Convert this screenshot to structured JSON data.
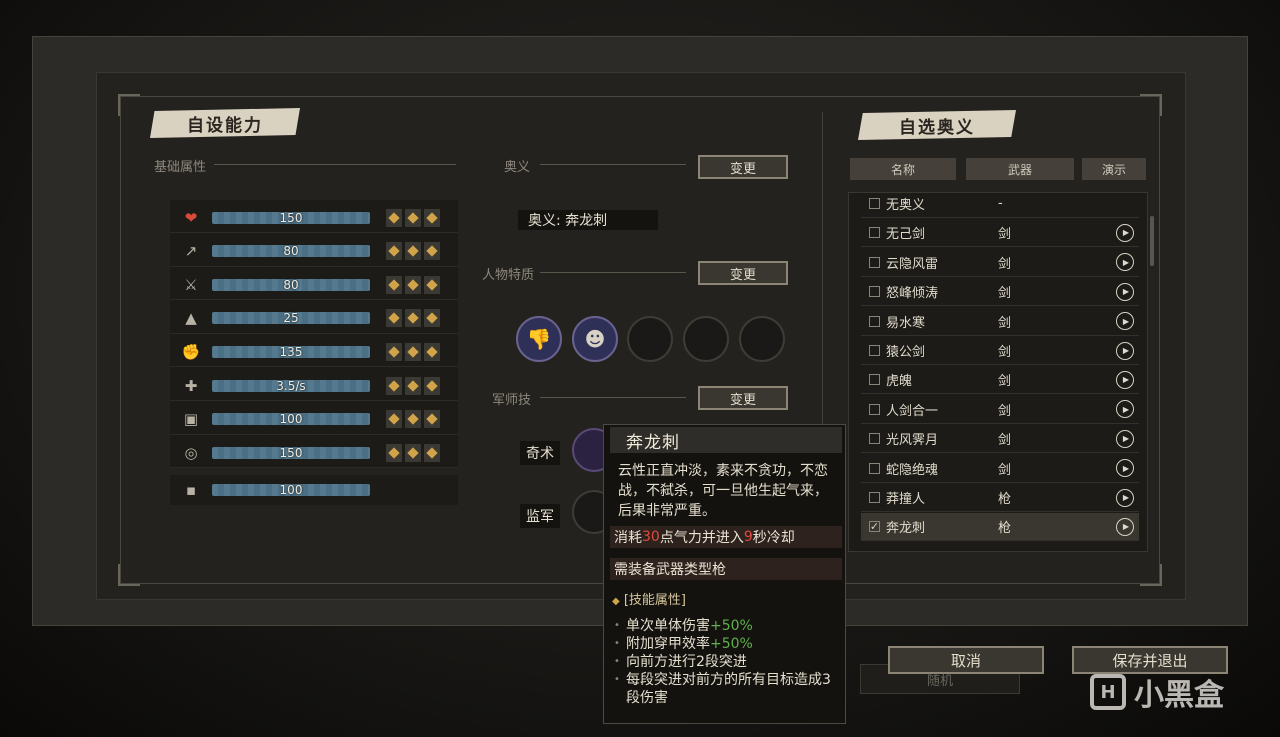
{
  "left_panel": {
    "title": "自设能力",
    "base_attr_label": "基础属性",
    "stats": [
      {
        "icon": "heart-icon",
        "glyph": "❤",
        "value": "150"
      },
      {
        "icon": "spear-icon",
        "glyph": "↗",
        "value": "80"
      },
      {
        "icon": "blade-icon",
        "glyph": "⚔",
        "value": "80"
      },
      {
        "icon": "boot-icon",
        "glyph": "▲",
        "value": "25"
      },
      {
        "icon": "fist-icon",
        "glyph": "✊",
        "value": "135"
      },
      {
        "icon": "regen-icon",
        "glyph": "✚",
        "value": "3.5/s"
      },
      {
        "icon": "book-icon",
        "glyph": "▣",
        "value": "100"
      },
      {
        "icon": "swirl-icon",
        "glyph": "◎",
        "value": "150"
      }
    ],
    "extra_stat": {
      "icon": "scroll-icon",
      "glyph": "▪",
      "value": "100"
    }
  },
  "middle": {
    "aoyi_label": "奥义",
    "change_label": "变更",
    "aoyi_value": "奥义: 奔龙刺",
    "traits_label": "人物特质",
    "strategist_label": "军师技",
    "qishu_label": "奇术",
    "jianjun_label": "监军"
  },
  "right_panel": {
    "title": "自选奥义",
    "columns": [
      "名称",
      "武器",
      "演示"
    ],
    "rows": [
      {
        "name": "无奥义",
        "weapon": "-",
        "checked": false,
        "play": false
      },
      {
        "name": "无己剑",
        "weapon": "剑",
        "checked": false,
        "play": true
      },
      {
        "name": "云隐风雷",
        "weapon": "剑",
        "checked": false,
        "play": true
      },
      {
        "name": "怒峰倾涛",
        "weapon": "剑",
        "checked": false,
        "play": true
      },
      {
        "name": "易水寒",
        "weapon": "剑",
        "checked": false,
        "play": true
      },
      {
        "name": "猿公剑",
        "weapon": "剑",
        "checked": false,
        "play": true
      },
      {
        "name": "虎魄",
        "weapon": "剑",
        "checked": false,
        "play": true
      },
      {
        "name": "人剑合一",
        "weapon": "剑",
        "checked": false,
        "play": true
      },
      {
        "name": "光风霁月",
        "weapon": "剑",
        "checked": false,
        "play": true
      },
      {
        "name": "蛇隐绝魂",
        "weapon": "剑",
        "checked": false,
        "play": true
      },
      {
        "name": "莽撞人",
        "weapon": "枪",
        "checked": false,
        "play": true
      },
      {
        "name": "奔龙刺",
        "weapon": "枪",
        "checked": true,
        "play": true
      }
    ]
  },
  "tooltip": {
    "title": "奔龙刺",
    "desc": "云性正直冲淡，素来不贪功，不恋战，不弑杀，可一旦他生起气来，后果非常严重。",
    "cost_pre": "消耗",
    "cost_num": "30",
    "cost_mid": "点气力并进入",
    "cost_cd": "9",
    "cost_post": "秒冷却",
    "req": "需装备武器类型枪",
    "section": "[技能属性]",
    "b1": "单次单体伤害",
    "b1_val": "+50%",
    "b2": "附加穿甲效率",
    "b2_val": "+50%",
    "b3": "向前方进行2段突进",
    "b4": "每段突进对前方的所有目标造成3段伤害"
  },
  "bottom": {
    "cancel": "取消",
    "save": "保存并退出",
    "random": "随机"
  },
  "watermark": "小黑盒",
  "watermark_logo": "H"
}
